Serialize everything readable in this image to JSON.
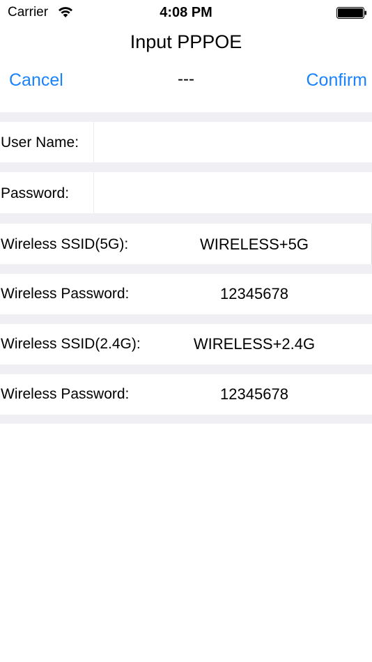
{
  "status_bar": {
    "carrier": "Carrier",
    "time": "4:08 PM",
    "wifi_icon": "wifi-icon",
    "battery_icon": "battery-icon"
  },
  "nav": {
    "title": "Input PPPOE",
    "cancel_label": "Cancel",
    "confirm_label": "Confirm",
    "center_text": "---",
    "accent_color": "#1a82fb"
  },
  "form": {
    "user_name_label": "User Name:",
    "user_name_value": "",
    "password_label": "Password:",
    "password_value": "",
    "ssid_5g_label": "Wireless SSID(5G):",
    "ssid_5g_value": "WIRELESS+5G",
    "password_5g_label": "Wireless Password:",
    "password_5g_value": "12345678",
    "ssid_24g_label": "Wireless SSID(2.4G):",
    "ssid_24g_value": "WIRELESS+2.4G",
    "password_24g_label": "Wireless Password:",
    "password_24g_value": "12345678"
  },
  "colors": {
    "separator": "#efeff4",
    "background": "#ffffff"
  }
}
